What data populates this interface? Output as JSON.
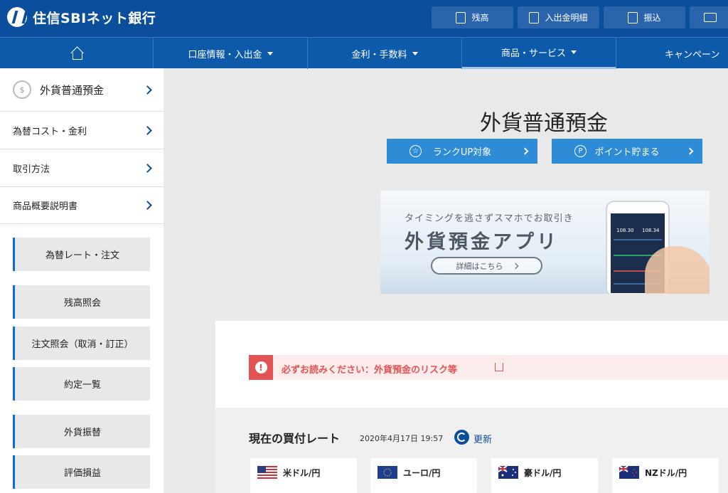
{
  "header": {
    "logo_text": "住信SBIネット銀行",
    "buttons": [
      {
        "label": "残高",
        "icon": "calculator-icon"
      },
      {
        "label": "入出金明細",
        "icon": "statement-icon"
      },
      {
        "label": "振込",
        "icon": "transfer-icon"
      },
      {
        "label": "",
        "icon": "mail-icon"
      }
    ]
  },
  "nav": {
    "home_icon": "home-icon",
    "items": [
      {
        "label": "口座情報・入出金"
      },
      {
        "label": "金利・手数料"
      },
      {
        "label": "商品・サービス"
      },
      {
        "label": "キャンペーン"
      }
    ]
  },
  "sidebar": {
    "title": "外貨普通預金",
    "title_icon_glyph": "$",
    "links": [
      {
        "label": "為替コスト・金利"
      },
      {
        "label": "取引方法"
      },
      {
        "label": "商品概要説明書"
      }
    ],
    "buttons": [
      {
        "label": "為替レート・注文"
      },
      {
        "label": "残高照会"
      },
      {
        "label": "注文照会（取消・訂正）"
      },
      {
        "label": "約定一覧"
      },
      {
        "label": "外貨振替"
      },
      {
        "label": "評価損益"
      }
    ]
  },
  "main": {
    "title": "外貨普通預金",
    "rank_button": "ランクUP対象",
    "point_button": "ポイント貯まる",
    "rank_glyph": "☆",
    "point_glyph": "P",
    "banner": {
      "subtitle": "タイミングを逃さずスマホでお取引き",
      "title": "外貨預金アプリ",
      "button": "詳細はこちら",
      "phone_num_1": "108.30",
      "phone_num_2": "108.34"
    },
    "alert": {
      "glyph": "!",
      "text": "必ずお読みください：外貨預金のリスク等"
    },
    "rates": {
      "title": "現在の買付レート",
      "timestamp": "2020年4月17日 19:57",
      "refresh": "更新",
      "currencies": [
        {
          "label": "米ドル/円",
          "flag": "us-flag"
        },
        {
          "label": "ユーロ/円",
          "flag": "eu-flag"
        },
        {
          "label": "豪ドル/円",
          "flag": "au-flag"
        },
        {
          "label": "NZドル/円",
          "flag": "nz-flag"
        }
      ]
    }
  },
  "colors": {
    "header_bg": "#0a4e9c",
    "nav_bg": "#0d5aaa",
    "button_blue": "#2e8bd6",
    "alert_red": "#e35353"
  }
}
